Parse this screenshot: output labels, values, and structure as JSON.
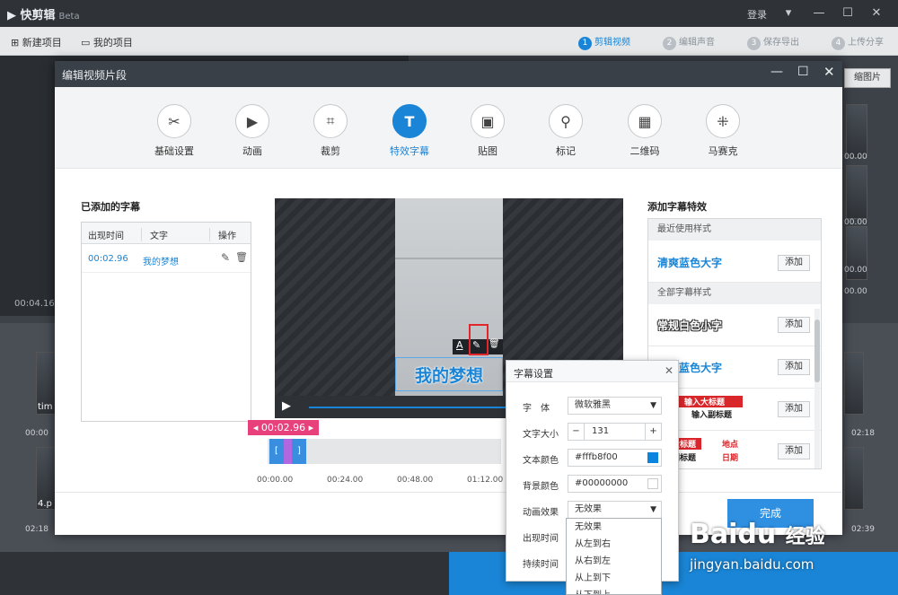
{
  "app": {
    "title": "快剪辑",
    "beta": "Beta",
    "login": "登录"
  },
  "toolbar": {
    "new_project": "新建项目",
    "my_projects": "我的项目",
    "steps": [
      {
        "num": "1",
        "label": "剪辑视频"
      },
      {
        "num": "2",
        "label": "编辑声音"
      },
      {
        "num": "3",
        "label": "保存导出"
      },
      {
        "num": "4",
        "label": "上传分享"
      }
    ]
  },
  "background": {
    "time_left": "00:04.16",
    "right_btn": "缩图片",
    "right_times": [
      "00.00",
      "00.00",
      "00.00",
      "00.00"
    ],
    "strip_times": [
      "00:00",
      "02:18",
      "02:18",
      "02:39"
    ],
    "clip_label_1": "tim",
    "clip_label_2": "4.p"
  },
  "dialog": {
    "title": "编辑视频片段",
    "tabs": [
      {
        "label": "基础设置",
        "icon": "scissors-icon",
        "glyph": "✂"
      },
      {
        "label": "动画",
        "icon": "animation-icon",
        "glyph": "▶"
      },
      {
        "label": "裁剪",
        "icon": "crop-icon",
        "glyph": "⌗"
      },
      {
        "label": "特效字幕",
        "icon": "text-icon",
        "glyph": "T"
      },
      {
        "label": "贴图",
        "icon": "image-icon",
        "glyph": "▣"
      },
      {
        "label": "标记",
        "icon": "pin-icon",
        "glyph": "⚲"
      },
      {
        "label": "二维码",
        "icon": "qrcode-icon",
        "glyph": "▦"
      },
      {
        "label": "马赛克",
        "icon": "mosaic-icon",
        "glyph": "⁜"
      }
    ],
    "active_tab": 3
  },
  "subtitles": {
    "section_title": "已添加的字幕",
    "headers": [
      "出现时间",
      "文字",
      "操作"
    ],
    "rows": [
      {
        "time": "00:02.96",
        "text": "我的梦想"
      }
    ]
  },
  "preview": {
    "caption": "我的梦想",
    "timecode": "00:02.96",
    "ticks": [
      "00:00.00",
      "00:24.00",
      "00:48.00",
      "01:12.00"
    ]
  },
  "effects": {
    "section_title": "添加字幕特效",
    "recent_label": "最近使用样式",
    "all_label": "全部字幕样式",
    "add_label": "添加",
    "recent": [
      {
        "name": "清爽蓝色大字"
      }
    ],
    "all": [
      {
        "name": "常规白色小字"
      },
      {
        "name": "清爽蓝色大字"
      },
      {
        "line1": "输入大标题",
        "line2": "输入副标题"
      },
      {
        "line1": "大标题",
        "tag": "地点",
        "line2": "副标题",
        "tag2": "日期"
      }
    ]
  },
  "popup": {
    "title": "字幕设置",
    "font_label": "字　体",
    "font_value": "微软雅黑",
    "size_label": "文字大小",
    "size_value": "131",
    "text_color_label": "文本颜色",
    "text_color_value": "#fffb8f00",
    "bg_color_label": "背景颜色",
    "bg_color_value": "#00000000",
    "anim_label": "动画效果",
    "anim_value": "无效果",
    "appear_label": "出现时间",
    "duration_label": "持续时间",
    "anim_options": [
      "无效果",
      "从左到右",
      "从右到左",
      "从上到下",
      "从下到上"
    ]
  },
  "confirm_label": "完成",
  "watermark": {
    "brand": "Baidu",
    "cn": "经验",
    "url": "jingyan.baidu.com"
  },
  "colors": {
    "accent": "#1a85d6",
    "highlight": "#e3262b",
    "timecode": "#e8407a",
    "swatch": "#0b84e0"
  }
}
